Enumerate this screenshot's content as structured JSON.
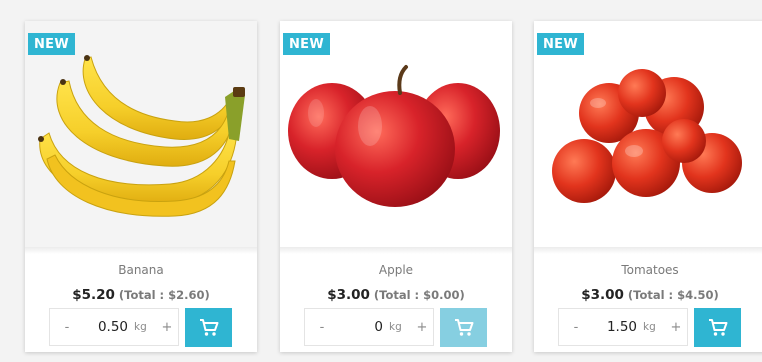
{
  "colors": {
    "accent": "#2fb5d2",
    "accent_disabled": "#86cfe1"
  },
  "products": [
    {
      "badge": "NEW",
      "name": "Banana",
      "price": "$5.20",
      "total": "(Total : $2.60)",
      "qty_minus": "-",
      "qty_value": "0.50",
      "qty_unit": "kg",
      "qty_plus": "+",
      "cart_icon": "cart-icon",
      "image_icon": "banana-bunch-image"
    },
    {
      "badge": "NEW",
      "name": "Apple",
      "price": "$3.00",
      "total": "(Total : $0.00)",
      "qty_minus": "-",
      "qty_value": "0",
      "qty_unit": "kg",
      "qty_plus": "+",
      "cart_icon": "cart-icon",
      "image_icon": "apples-image"
    },
    {
      "badge": "NEW",
      "name": "Tomatoes",
      "price": "$3.00",
      "total": "(Total : $4.50)",
      "qty_minus": "-",
      "qty_value": "1.50",
      "qty_unit": "kg",
      "qty_plus": "+",
      "cart_icon": "cart-icon",
      "image_icon": "tomatoes-image"
    }
  ]
}
